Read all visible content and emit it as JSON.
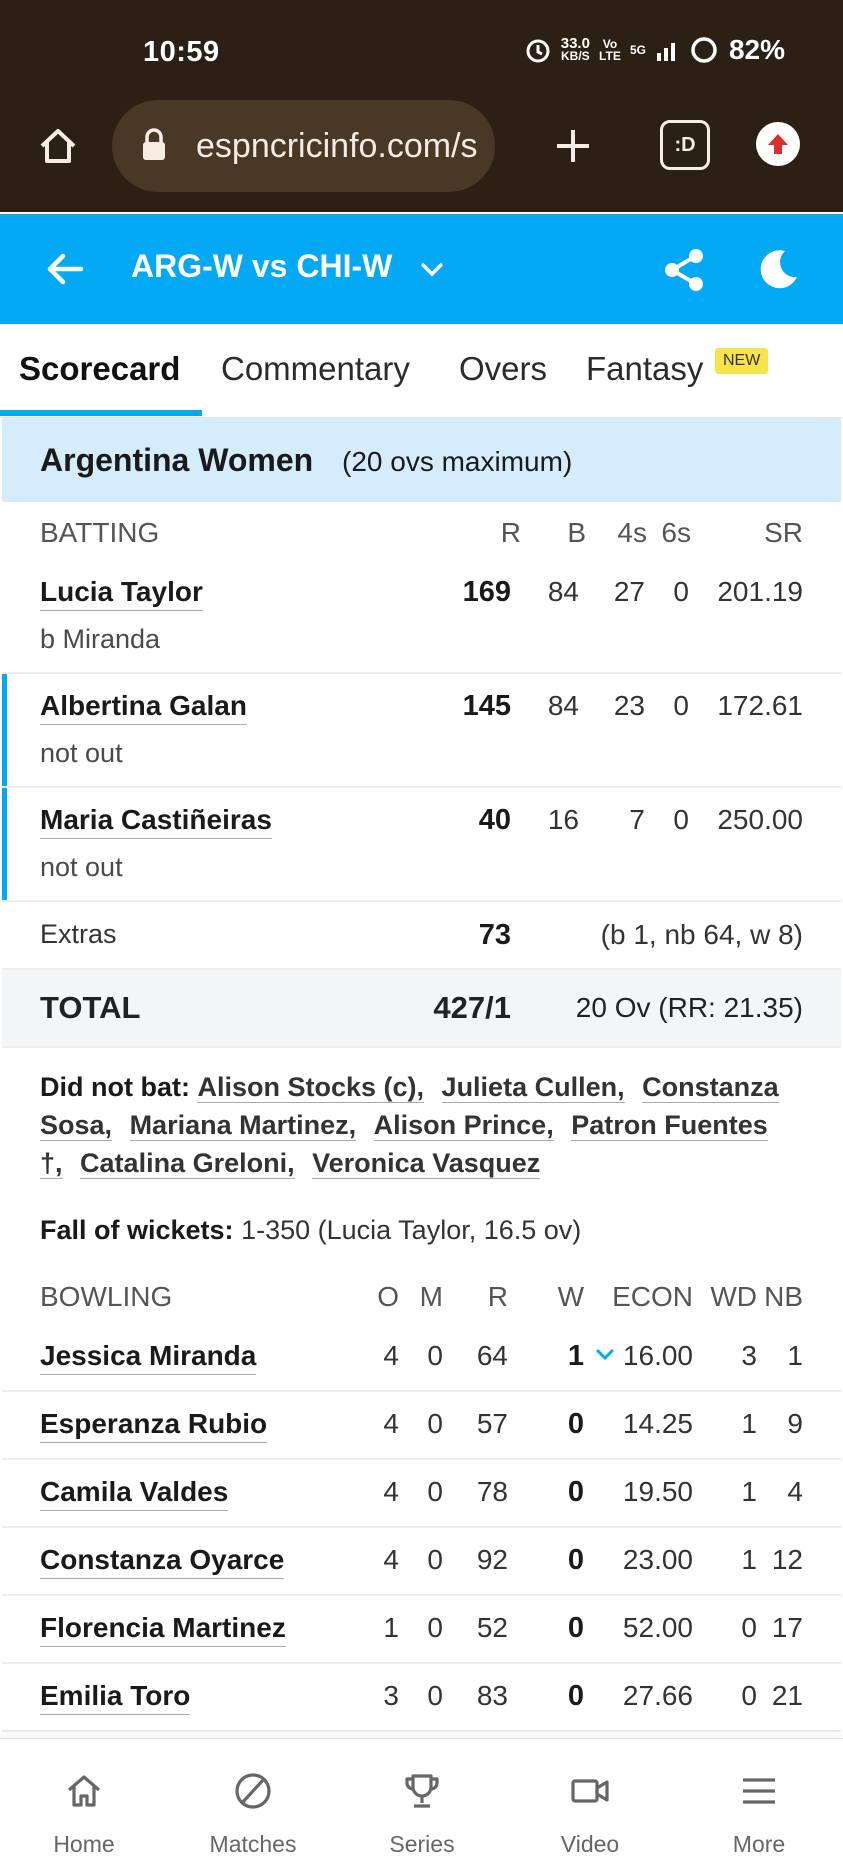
{
  "status_bar": {
    "time": "10:59",
    "net_speed": "33.0",
    "net_unit": "KB/S",
    "volte": "Vo LTE",
    "network": "5G",
    "battery": "82%"
  },
  "browser": {
    "url": "espncricinfo.com/s"
  },
  "header": {
    "title": "ARG-W vs CHI-W"
  },
  "tabs": [
    {
      "label": "Scorecard",
      "active": true
    },
    {
      "label": "Commentary"
    },
    {
      "label": "Overs"
    },
    {
      "label": "Fantasy",
      "badge": "NEW"
    }
  ],
  "team": {
    "name": "Argentina Women",
    "overs": "(20 ovs maximum)"
  },
  "batting": {
    "columns": [
      "BATTING",
      "R",
      "B",
      "4s",
      "6s",
      "SR"
    ],
    "rows": [
      {
        "name": "Lucia Taylor",
        "dismissal": "b Miranda",
        "r": "169",
        "b": "84",
        "fours": "27",
        "sixes": "0",
        "sr": "201.19",
        "at_crease": false
      },
      {
        "name": "Albertina Galan",
        "dismissal": "not out",
        "r": "145",
        "b": "84",
        "fours": "23",
        "sixes": "0",
        "sr": "172.61",
        "at_crease": true
      },
      {
        "name": "Maria Castiñeiras",
        "dismissal": "not out",
        "r": "40",
        "b": "16",
        "fours": "7",
        "sixes": "0",
        "sr": "250.00",
        "at_crease": true
      }
    ],
    "extras": {
      "label": "Extras",
      "value": "73",
      "detail": "(b 1, nb 64, w 8)"
    },
    "total": {
      "label": "TOTAL",
      "value": "427/1",
      "detail": "20 Ov (RR: 21.35)"
    }
  },
  "did_not_bat": {
    "label": "Did not bat:",
    "players": [
      "Alison Stocks (c),",
      "Julieta Cullen,",
      "Constanza Sosa,",
      "Mariana Martinez,",
      "Alison Prince,",
      "Patron Fuentes †,",
      "Catalina Greloni,",
      "Veronica Vasquez"
    ]
  },
  "fall_of_wickets": {
    "label": "Fall of wickets:",
    "value": "1-350 (Lucia Taylor, 16.5 ov)"
  },
  "bowling": {
    "columns": [
      "BOWLING",
      "O",
      "M",
      "R",
      "W",
      "ECON",
      "WD",
      "NB"
    ],
    "rows": [
      {
        "name": "Jessica Miranda",
        "o": "4",
        "m": "0",
        "r": "64",
        "w": "1",
        "econ": "16.00",
        "wd": "3",
        "nb": "1",
        "expand": true
      },
      {
        "name": "Esperanza Rubio",
        "o": "4",
        "m": "0",
        "r": "57",
        "w": "0",
        "econ": "14.25",
        "wd": "1",
        "nb": "9"
      },
      {
        "name": "Camila Valdes",
        "o": "4",
        "m": "0",
        "r": "78",
        "w": "0",
        "econ": "19.50",
        "wd": "1",
        "nb": "4"
      },
      {
        "name": "Constanza Oyarce",
        "o": "4",
        "m": "0",
        "r": "92",
        "w": "0",
        "econ": "23.00",
        "wd": "1",
        "nb": "12"
      },
      {
        "name": "Florencia Martinez",
        "o": "1",
        "m": "0",
        "r": "52",
        "w": "0",
        "econ": "52.00",
        "wd": "0",
        "nb": "17"
      },
      {
        "name": "Emilia Toro",
        "o": "3",
        "m": "0",
        "r": "83",
        "w": "0",
        "econ": "27.66",
        "wd": "0",
        "nb": "21"
      }
    ]
  },
  "bottom_nav": [
    {
      "label": "Home",
      "icon": "home-icon"
    },
    {
      "label": "Matches",
      "icon": "ball-icon"
    },
    {
      "label": "Series",
      "icon": "trophy-icon"
    },
    {
      "label": "Video",
      "icon": "video-icon"
    },
    {
      "label": "More",
      "icon": "menu-icon"
    }
  ],
  "colors": {
    "accent": "#03a9f4",
    "team_bg": "#d4ecfb",
    "browser_bg": "#2c1f14"
  }
}
